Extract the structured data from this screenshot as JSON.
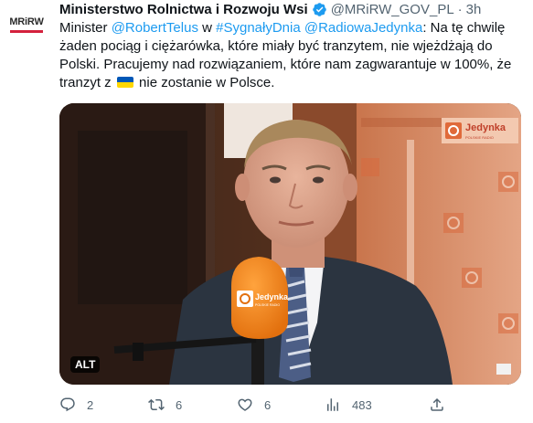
{
  "account": {
    "avatar_text": "MRiRW",
    "display_name": "Ministerstwo Rolnictwa i Rozwoju Wsi",
    "handle": "@MRiRW_GOV_PL",
    "separator": "·",
    "time": "3h",
    "verified_icon": "verified-badge-icon",
    "brand_color": "#d4213d"
  },
  "tweet": {
    "part1": "Minister ",
    "mention1": "@RobertTelus",
    "part2": " w ",
    "hashtag": "#SygnałyDnia",
    "part3": " ",
    "mention2": "@RadiowaJedynka",
    "part4": ":  Na tę chwilę żaden pociąg i ciężarówka, które miały być tranzytem, nie wjeżdżają do Polski. Pracujemy nad rozwiązaniem, które nam zagwarantuje w 100%, że tranzyt z ",
    "flag_icon": "ukraine-flag-icon",
    "part5": " nie zostanie w Polsce."
  },
  "media": {
    "alt_label": "ALT",
    "mic_label": "Jedynka",
    "mic_sublabel": "POLSKIE RADIO",
    "backdrop_label": "Jedynka",
    "backdrop_sublabel": "POLSKIE RADIO"
  },
  "actions": {
    "replies": "2",
    "retweets": "6",
    "likes": "6",
    "views": "483"
  },
  "colors": {
    "link": "#1d9bf0",
    "muted": "#536471",
    "mic": "#f08419"
  }
}
